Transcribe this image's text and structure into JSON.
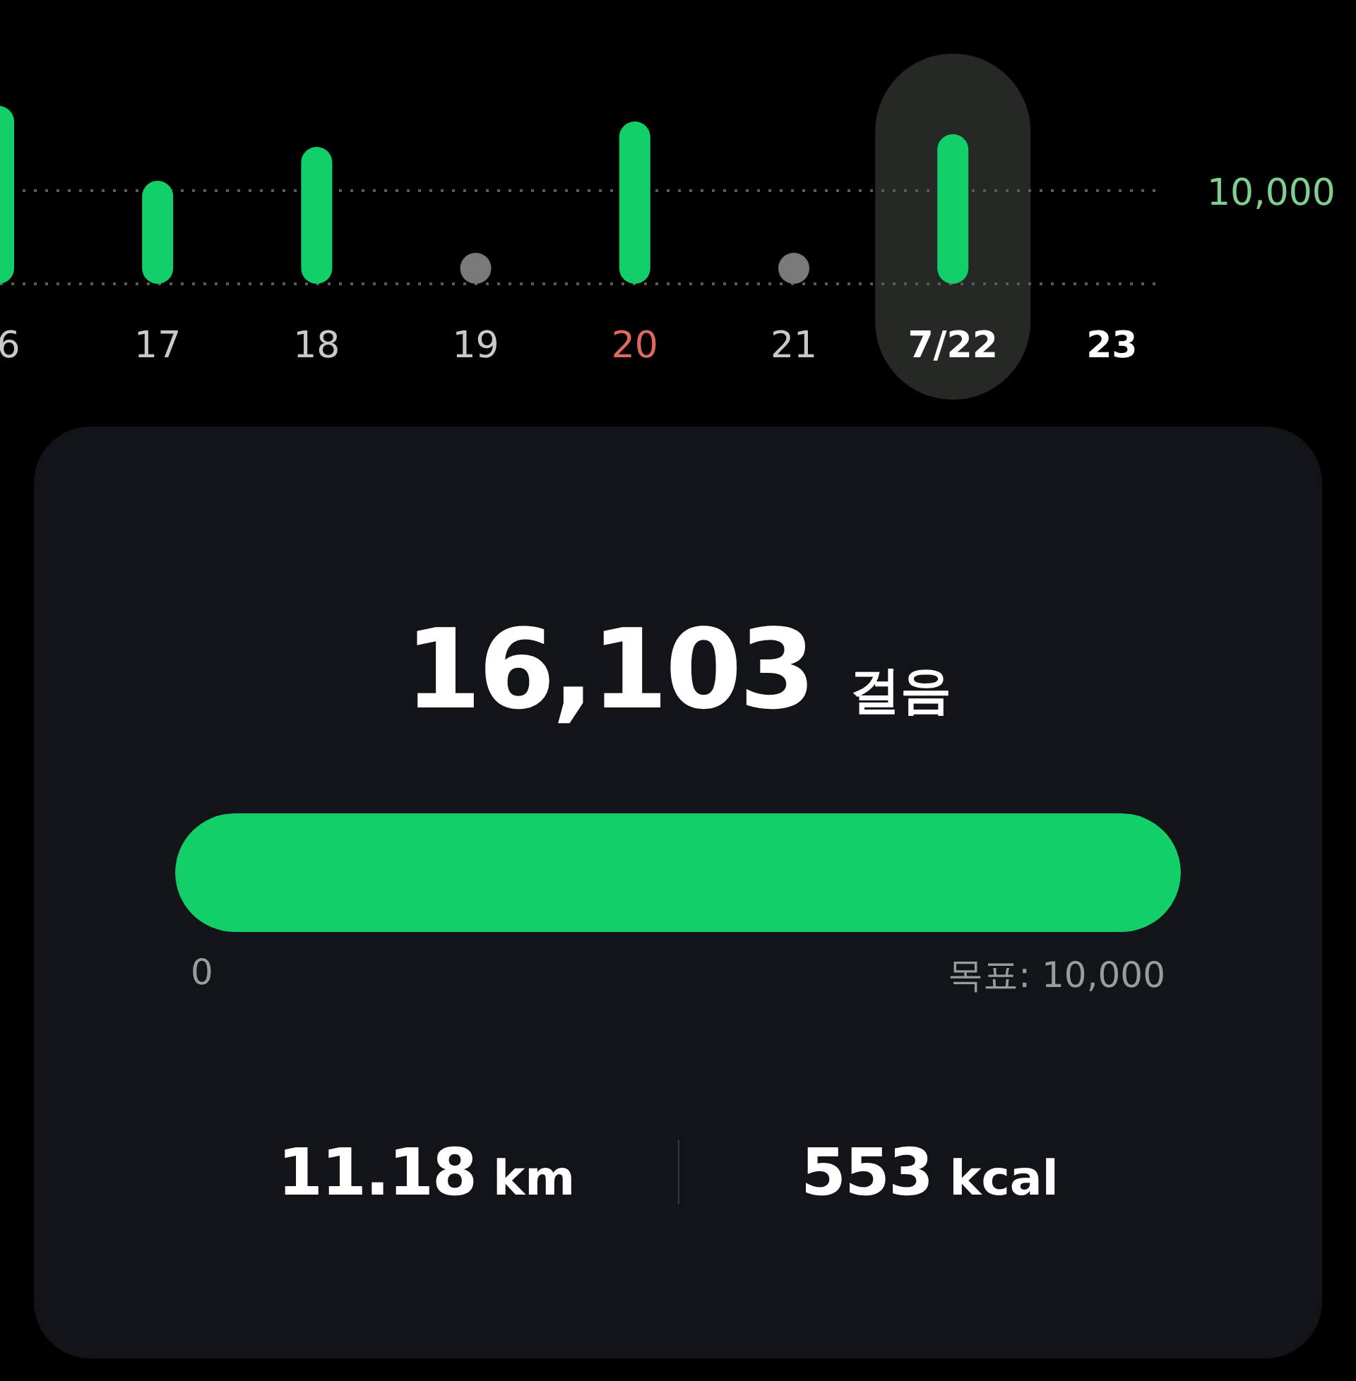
{
  "week_chart": {
    "goal_line_label": "10,000",
    "days": [
      {
        "label": "6",
        "kind": "weekday",
        "walked": true,
        "selected": false
      },
      {
        "label": "17",
        "kind": "weekday",
        "walked": true,
        "selected": false
      },
      {
        "label": "18",
        "kind": "weekday",
        "walked": true,
        "selected": false
      },
      {
        "label": "19",
        "kind": "weekday",
        "walked": false,
        "selected": false
      },
      {
        "label": "20",
        "kind": "holiday",
        "walked": true,
        "selected": false
      },
      {
        "label": "21",
        "kind": "weekday",
        "walked": false,
        "selected": false
      },
      {
        "label": "7/22",
        "kind": "today",
        "walked": true,
        "selected": true
      },
      {
        "label": "23",
        "kind": "future",
        "selected": false
      }
    ]
  },
  "summary": {
    "steps": "16,103",
    "steps_unit": "걸음",
    "goal_progress": {
      "level": 1,
      "min_label": "0",
      "goal_label": "목표: 10,000"
    },
    "stats": [
      {
        "value": "11.18",
        "unit": "km"
      },
      {
        "value": "553",
        "unit": "kcal"
      }
    ]
  }
}
